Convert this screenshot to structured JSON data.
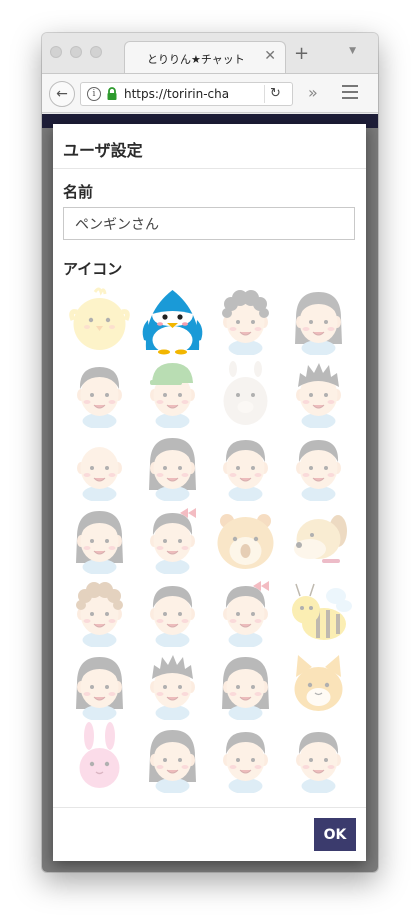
{
  "browser": {
    "tab_title": "とりりん★チャット",
    "tab_close": "✕",
    "new_tab": "+",
    "url": "https://toririn-cha",
    "back_icon": "←",
    "reload_icon": "↻",
    "more_icon": "»",
    "info_icon": "i"
  },
  "modal": {
    "title": "ユーザ設定",
    "name_label": "名前",
    "name_value": "ペンギンさん",
    "icon_label": "アイコン",
    "ok_label": "OK",
    "selected_icon": 1
  },
  "icons": [
    {
      "name": "chick-icon",
      "kind": "chick",
      "color": "#fbe073"
    },
    {
      "name": "penguin-icon",
      "kind": "penguin",
      "color": "#1a9ad7"
    },
    {
      "name": "curly-boy-icon",
      "kind": "person",
      "hair": "#555555",
      "curly": true
    },
    {
      "name": "long-hair-girl-icon",
      "kind": "person",
      "hair": "#555555",
      "long": true
    },
    {
      "name": "surprised-boy-icon",
      "kind": "person",
      "hair": "#4a4a4a"
    },
    {
      "name": "cap-boy-icon",
      "kind": "person",
      "hair": "#4aa83a",
      "cap": true
    },
    {
      "name": "alpaca-icon",
      "kind": "alpaca",
      "color": "#e8e0d8"
    },
    {
      "name": "spiky-boy-icon",
      "kind": "person",
      "hair": "#4a4a4a",
      "spiky": true
    },
    {
      "name": "bald-man-icon",
      "kind": "person",
      "hair": "none"
    },
    {
      "name": "glasses-girl-icon",
      "kind": "person",
      "hair": "#4a4a4a",
      "long": true
    },
    {
      "name": "smiling-girl-icon",
      "kind": "person",
      "hair": "#4a4a4a"
    },
    {
      "name": "happy-boy-icon",
      "kind": "person",
      "hair": "#4a4a4a"
    },
    {
      "name": "bob-girl-icon",
      "kind": "person",
      "hair": "#4a4a4a",
      "long": true
    },
    {
      "name": "ribbon-girl-icon",
      "kind": "person",
      "hair": "#4a4a4a",
      "ribbon": true
    },
    {
      "name": "hamster-icon",
      "kind": "hamster",
      "color": "#f0c070"
    },
    {
      "name": "dog-icon",
      "kind": "dog",
      "color": "#f0cf8a"
    },
    {
      "name": "curly-girl-icon",
      "kind": "person",
      "hair": "#b98a5a",
      "curly": true
    },
    {
      "name": "boy-icon",
      "kind": "person",
      "hair": "#4a4a4a"
    },
    {
      "name": "flower-girl-icon",
      "kind": "person",
      "hair": "#4a4a4a",
      "ribbon": true
    },
    {
      "name": "bee-icon",
      "kind": "bee",
      "color": "#f5d43a"
    },
    {
      "name": "pigtail-girl-icon",
      "kind": "person",
      "hair": "#4a4a4a",
      "long": true
    },
    {
      "name": "grinning-boy-icon",
      "kind": "person",
      "hair": "#4a4a4a",
      "spiky": true
    },
    {
      "name": "headband-girl-icon",
      "kind": "person",
      "hair": "#4a4a4a",
      "long": true
    },
    {
      "name": "cat-icon",
      "kind": "cat",
      "color": "#f4b84a"
    },
    {
      "name": "rabbit-icon",
      "kind": "rabbit",
      "color": "#f6a6c8"
    },
    {
      "name": "short-hair-girl-icon",
      "kind": "person",
      "hair": "#4a4a4a",
      "long": true
    },
    {
      "name": "calm-girl-icon",
      "kind": "person",
      "hair": "#4a4a4a"
    },
    {
      "name": "leaf-boy-icon",
      "kind": "person",
      "hair": "#4a4a4a"
    }
  ]
}
